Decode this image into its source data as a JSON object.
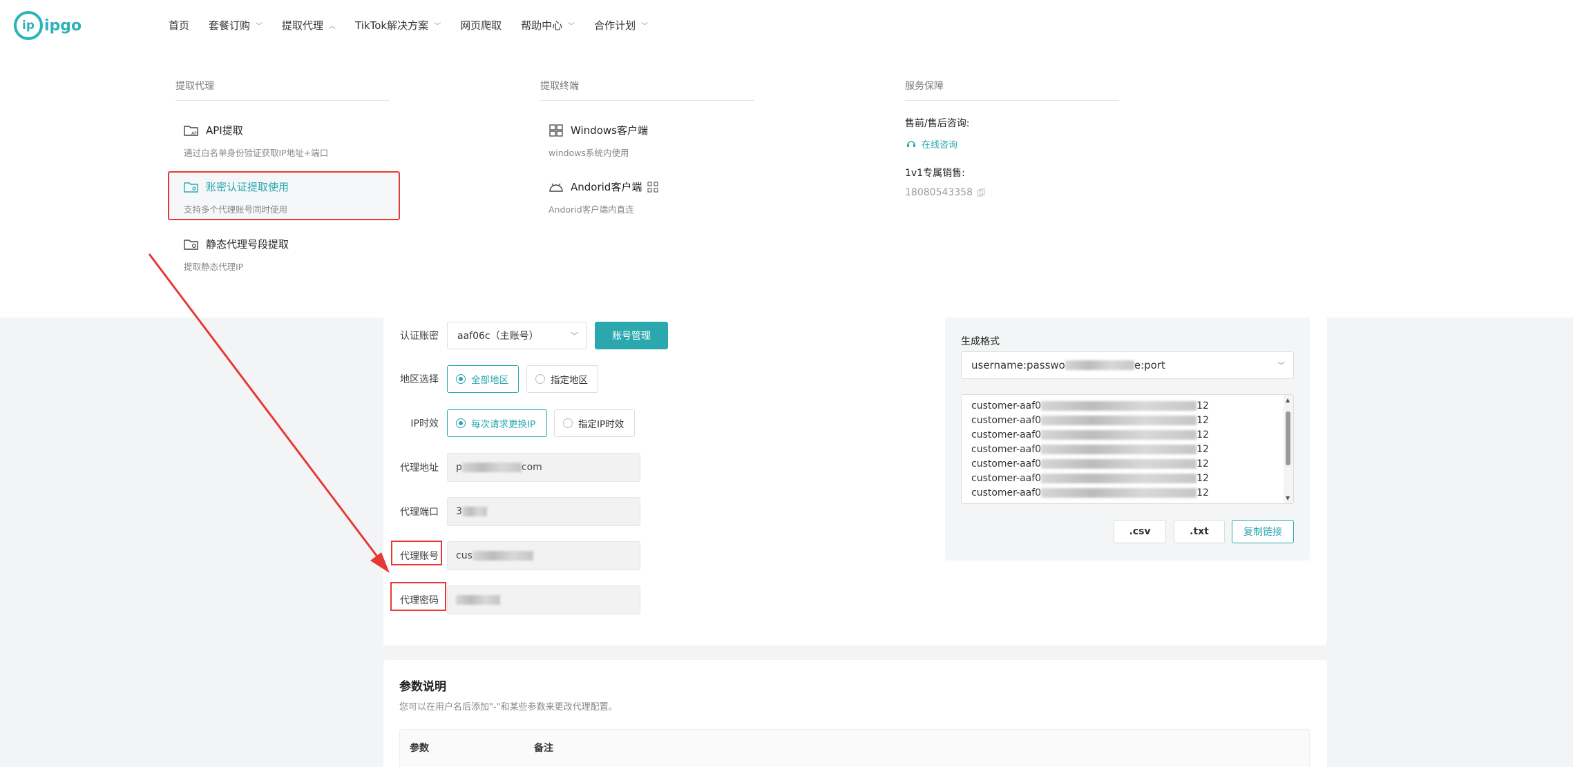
{
  "brand": {
    "logo_mark": "ip",
    "logo_text": "ipgo"
  },
  "nav": [
    {
      "label": "首页",
      "has_menu": false
    },
    {
      "label": "套餐订购",
      "has_menu": true,
      "expanded": false
    },
    {
      "label": "提取代理",
      "has_menu": true,
      "expanded": true
    },
    {
      "label": "TikTok解决方案",
      "has_menu": true,
      "expanded": false
    },
    {
      "label": "网页爬取",
      "has_menu": false
    },
    {
      "label": "帮助中心",
      "has_menu": true,
      "expanded": false
    },
    {
      "label": "合作计划",
      "has_menu": true,
      "expanded": false
    }
  ],
  "dropdown": {
    "col1": {
      "title": "提取代理",
      "items": [
        {
          "label": "API提取",
          "desc": "通过白名单身份验证获取IP地址+端口",
          "icon": "api-folder-icon"
        },
        {
          "label": "账密认证提取使用",
          "desc": "支持多个代理账号同时使用",
          "icon": "user-folder-icon",
          "selected": true
        },
        {
          "label": "静态代理号段提取",
          "desc": "提取静态代理IP",
          "icon": "location-folder-icon"
        }
      ]
    },
    "col2": {
      "title": "提取终端",
      "items": [
        {
          "label": "Windows客户端",
          "desc": "windows系统内使用",
          "icon": "windows-icon"
        },
        {
          "label": "Andorid客户端",
          "desc": "Andorid客户端内直连",
          "icon": "android-icon"
        }
      ]
    },
    "col3": {
      "title": "服务保障",
      "consult_label": "售前/售后咨询:",
      "consult_link": "在线咨询",
      "sales_label": "1v1专属销售:",
      "sales_phone": "18080543358"
    }
  },
  "form": {
    "auth_account_label": "认证账密",
    "auth_account_value": "aaf06c（主账号）",
    "account_manage_button": "账号管理",
    "region_label": "地区选择",
    "region_options": [
      {
        "label": "全部地区",
        "selected": true
      },
      {
        "label": "指定地区",
        "selected": false
      }
    ],
    "ip_ttl_label": "IP时效",
    "ip_ttl_options": [
      {
        "label": "每次请求更换IP",
        "selected": true
      },
      {
        "label": "指定IP时效",
        "selected": false
      }
    ],
    "proxy_address_label": "代理地址",
    "proxy_address_prefix": "p",
    "proxy_address_suffix": "com",
    "proxy_port_label": "代理端口",
    "proxy_port_prefix": "3",
    "proxy_account_label": "代理账号",
    "proxy_account_prefix": "cus",
    "proxy_password_label": "代理密码"
  },
  "output": {
    "format_label": "生成格式",
    "format_value_prefix": "username:passwo",
    "format_value_suffix": "e:port",
    "lines": [
      {
        "prefix": "customer-aaf0",
        "suffix": "12"
      },
      {
        "prefix": "customer-aaf0",
        "suffix": "12"
      },
      {
        "prefix": "customer-aaf0",
        "suffix": "12"
      },
      {
        "prefix": "customer-aaf0",
        "suffix": "12"
      },
      {
        "prefix": "customer-aaf0",
        "suffix": "12"
      },
      {
        "prefix": "customer-aaf0",
        "suffix": "12"
      },
      {
        "prefix": "customer-aaf0",
        "suffix": "12"
      }
    ],
    "csv_button": ".csv",
    "txt_button": ".txt",
    "copy_button": "复制链接"
  },
  "params": {
    "title": "参数说明",
    "subtitle": "您可以在用户名后添加\"-\"和某些参数来更改代理配置。",
    "col_param": "参数",
    "col_note": "备注"
  },
  "colors": {
    "accent": "#2aa8ae",
    "annotation": "#e53935"
  }
}
